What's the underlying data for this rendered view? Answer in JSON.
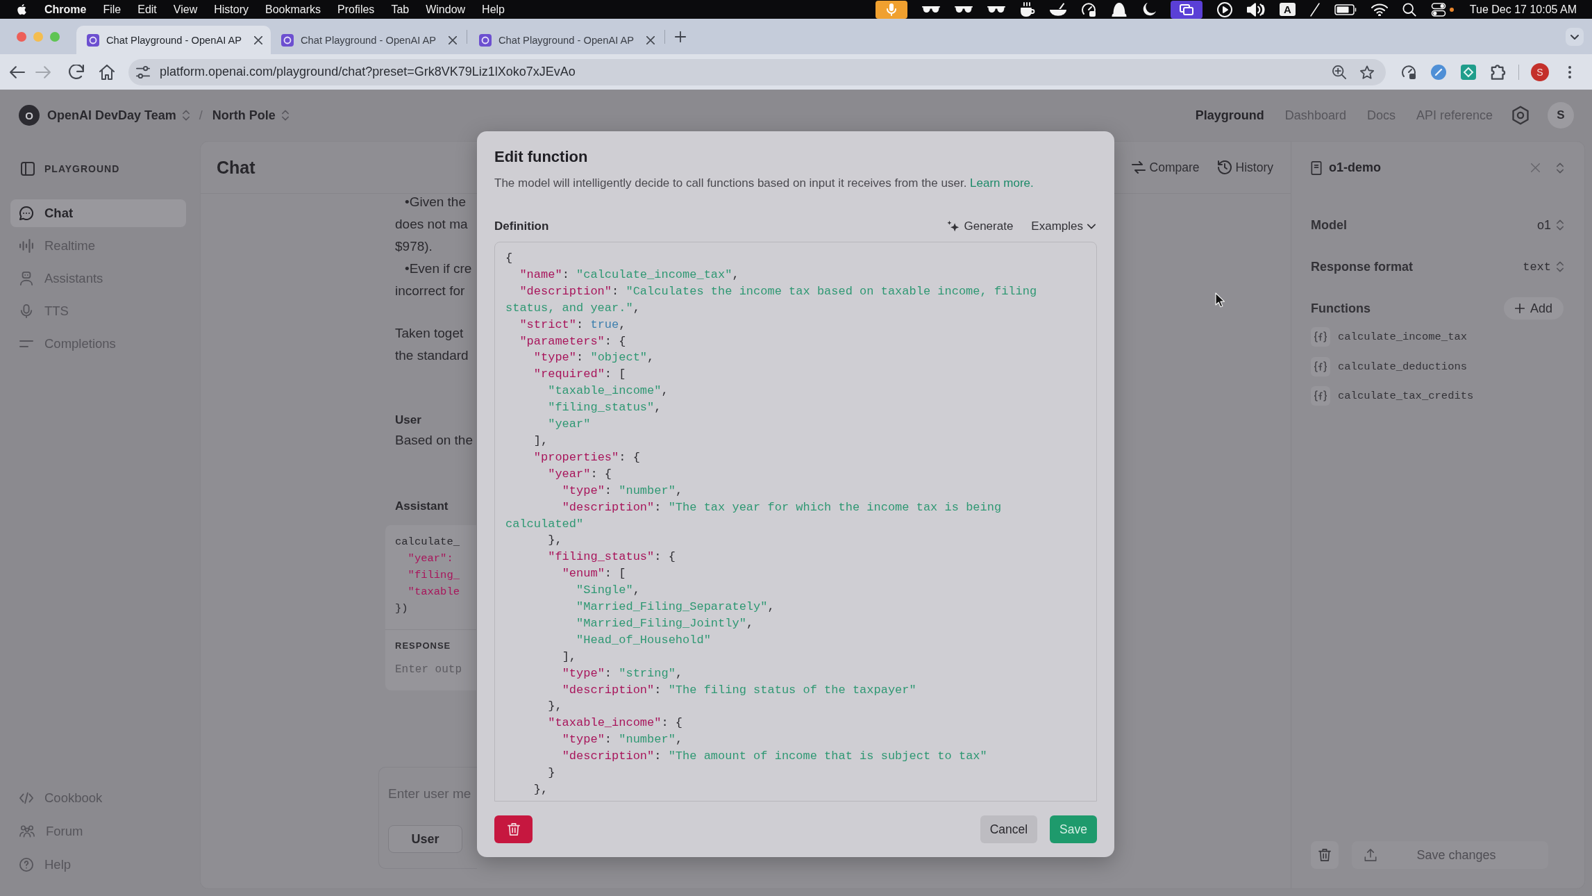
{
  "menu_bar": {
    "app": "Chrome",
    "items": [
      "File",
      "Edit",
      "View",
      "History",
      "Bookmarks",
      "Profiles",
      "Tab",
      "Window",
      "Help"
    ],
    "input_source": "A",
    "clock": "Tue Dec 17 10:05 AM"
  },
  "browser": {
    "tabs": [
      {
        "title": "Chat Playground - OpenAI AP",
        "selected": true
      },
      {
        "title": "Chat Playground - OpenAI AP",
        "selected": false
      },
      {
        "title": "Chat Playground - OpenAI AP",
        "selected": false
      }
    ],
    "forward_disabled": true,
    "url": "platform.openai.com/playground/chat?preset=Grk8VK79Liz1lXoko7xJEvAo",
    "profile_initial": "S"
  },
  "header": {
    "org_initial": "O",
    "org": "OpenAI DevDay Team",
    "separator": "/",
    "project": "North Pole",
    "nav": [
      {
        "label": "Playground",
        "selected": true
      },
      {
        "label": "Dashboard",
        "selected": false
      },
      {
        "label": "Docs",
        "selected": false
      },
      {
        "label": "API reference",
        "selected": false
      }
    ],
    "user_initial": "S"
  },
  "sidebar": {
    "title": "PLAYGROUND",
    "items": [
      {
        "label": "Chat",
        "selected": true
      },
      {
        "label": "Realtime",
        "selected": false
      },
      {
        "label": "Assistants",
        "selected": false
      },
      {
        "label": "TTS",
        "selected": false
      },
      {
        "label": "Completions",
        "selected": false
      }
    ],
    "footer": [
      "Cookbook",
      "Forum",
      "Help"
    ]
  },
  "chat": {
    "title": "Chat",
    "actions": [
      "Compare",
      "History"
    ],
    "paragraphs": [
      [
        {
          "kind": "bullet",
          "text": "•Given the"
        },
        {
          "kind": "line",
          "text": "does not ma"
        },
        {
          "kind": "line",
          "text": "$978)."
        },
        {
          "kind": "bullet",
          "text": "•Even if cre"
        },
        {
          "kind": "line",
          "text": "incorrect for"
        }
      ],
      [
        {
          "kind": "line",
          "text": "Taken toget"
        },
        {
          "kind": "line",
          "text": "the standard"
        }
      ]
    ],
    "user_role": "User",
    "user_message": "Based on the",
    "assistant_role": "Assistant",
    "tool_call": [
      "calculate_",
      "  \"year\":",
      "  \"filing_",
      "  \"taxable",
      "})"
    ],
    "response_label": "RESPONSE",
    "response_placeholder": "Enter outp",
    "composer_placeholder": "Enter user me",
    "role_button": "User"
  },
  "preset": {
    "name": "o1-demo",
    "settings": [
      {
        "label": "Model",
        "value": "o1",
        "kind": "sans"
      },
      {
        "label": "Response format",
        "value": "text",
        "kind": "mono"
      }
    ],
    "functions_label": "Functions",
    "add_label": "Add",
    "functions": [
      "calculate_income_tax",
      "calculate_deductions",
      "calculate_tax_credits"
    ],
    "save_label": "Save changes"
  },
  "modal": {
    "title": "Edit function",
    "description": "The model will intelligently decide to call functions based on input it receives from the user.",
    "link": "Learn more.",
    "definition_label": "Definition",
    "generate_label": "Generate",
    "examples_label": "Examples",
    "code": [
      "{",
      "  \"name\": \"calculate_income_tax\",",
      "  \"description\": \"Calculates the income tax based on taxable income, filing status, and year.\",",
      "  \"strict\": true,",
      "  \"parameters\": {",
      "    \"type\": \"object\",",
      "    \"required\": [",
      "      \"taxable_income\",",
      "      \"filing_status\",",
      "      \"year\"",
      "    ],",
      "    \"properties\": {",
      "      \"year\": {",
      "        \"type\": \"number\",",
      "        \"description\": \"The tax year for which the income tax is being calculated\"",
      "      },",
      "      \"filing_status\": {",
      "        \"enum\": [",
      "          \"Single\",",
      "          \"Married_Filing_Separately\",",
      "          \"Married_Filing_Jointly\",",
      "          \"Head_of_Household\"",
      "        ],",
      "        \"type\": \"string\",",
      "        \"description\": \"The filing status of the taxpayer\"",
      "      },",
      "      \"taxable_income\": {",
      "        \"type\": \"number\",",
      "        \"description\": \"The amount of income that is subject to tax\"",
      "      }",
      "    },"
    ],
    "cancel_label": "Cancel",
    "save_label": "Save"
  }
}
